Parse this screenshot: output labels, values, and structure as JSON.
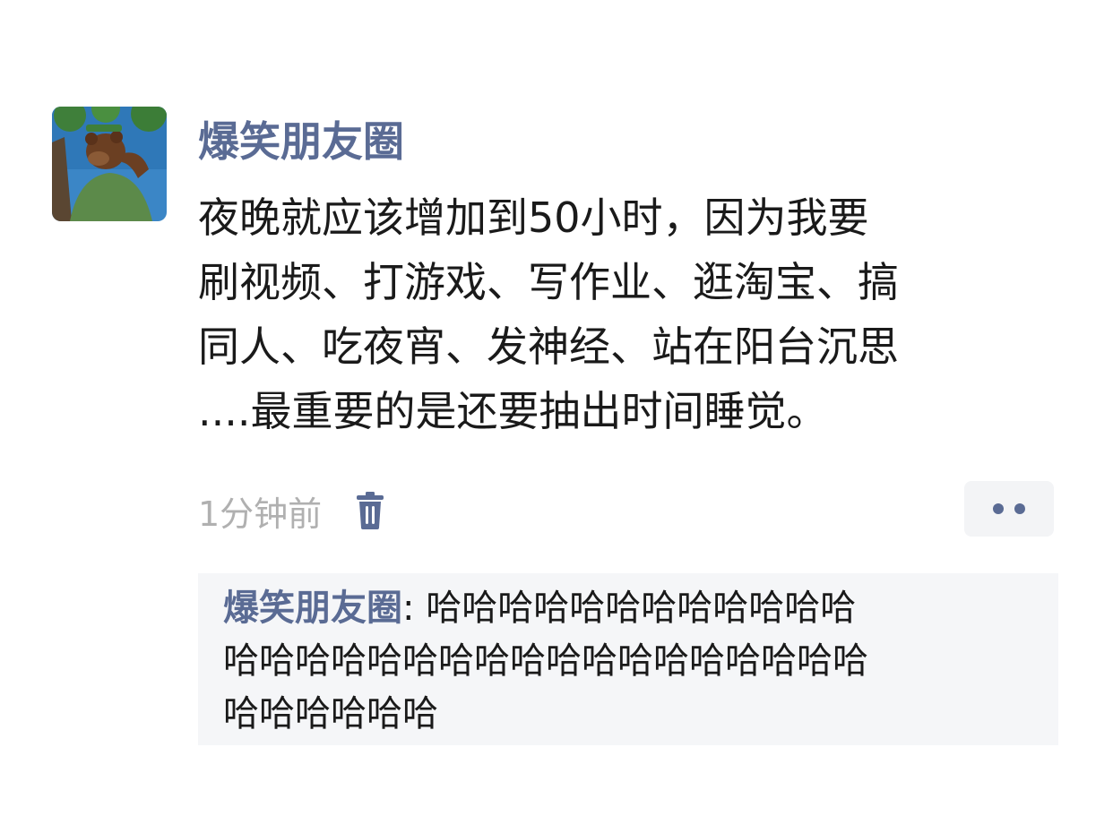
{
  "post": {
    "author": "爆笑朋友圈",
    "content_lines": [
      "夜晚就应该增加到50小时，因为我要",
      "刷视频、打游戏、写作业、逛淘宝、搞",
      "同人、吃夜宵、发神经、站在阳台沉思",
      "....最重要的是还要抽出时间睡觉。"
    ],
    "time": "1分钟前",
    "delete_icon": "trash-icon",
    "more_icon": "more-dots-icon"
  },
  "comments": [
    {
      "author": "爆笑朋友圈",
      "separator": ": ",
      "text_lines": [
        "哈哈哈哈哈哈哈哈哈哈哈哈",
        "哈哈哈哈哈哈哈哈哈哈哈哈哈哈哈哈哈哈",
        "哈哈哈哈哈哈"
      ]
    }
  ],
  "colors": {
    "name_blue": "#5a6b94",
    "text": "#1a1a1a",
    "time_gray": "#b0b0b0",
    "comment_bg": "#f5f6f8"
  }
}
